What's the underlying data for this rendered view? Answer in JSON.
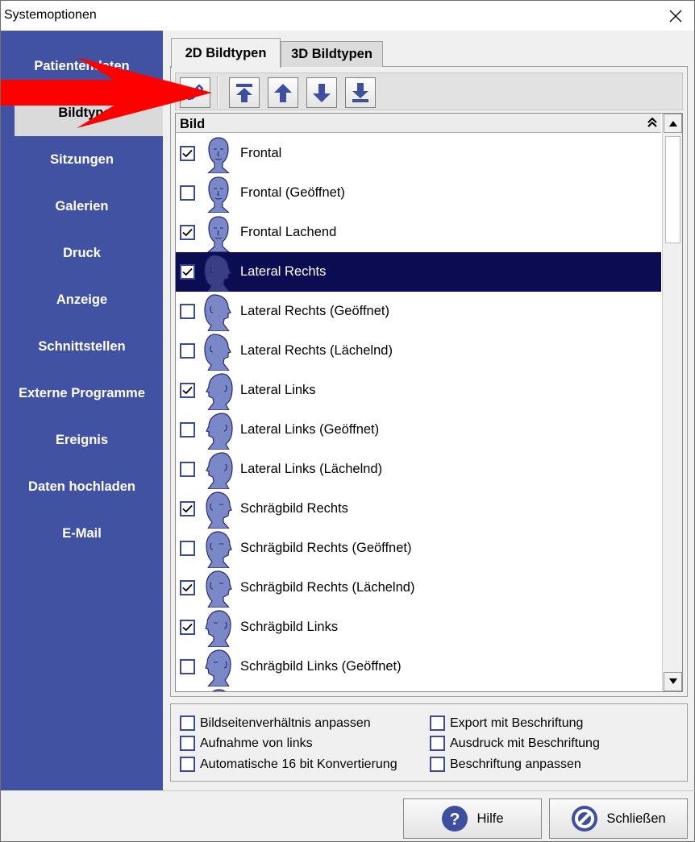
{
  "window": {
    "title": "Systemoptionen"
  },
  "sidebar": {
    "items": [
      {
        "label": "Patientendaten"
      },
      {
        "label": "Bildtypen",
        "active": true
      },
      {
        "label": "Sitzungen"
      },
      {
        "label": "Galerien"
      },
      {
        "label": "Druck"
      },
      {
        "label": "Anzeige"
      },
      {
        "label": "Schnittstellen"
      },
      {
        "label": "Externe Programme"
      },
      {
        "label": "Ereignis"
      },
      {
        "label": "Daten hochladen"
      },
      {
        "label": "E-Mail"
      }
    ]
  },
  "tabs": [
    {
      "label": "2D Bildtypen",
      "active": true
    },
    {
      "label": "3D Bildtypen",
      "active": false
    }
  ],
  "toolbar": {
    "icons": [
      "edit-icon",
      "move-to-top-icon",
      "move-up-icon",
      "move-down-icon",
      "move-to-bottom-icon"
    ]
  },
  "list": {
    "header": "Bild",
    "rows": [
      {
        "label": "Frontal",
        "checked": true,
        "view": "front"
      },
      {
        "label": "Frontal (Geöffnet)",
        "checked": false,
        "view": "front"
      },
      {
        "label": "Frontal Lachend",
        "checked": true,
        "view": "front"
      },
      {
        "label": "Lateral Rechts",
        "checked": true,
        "view": "right",
        "selected": true
      },
      {
        "label": "Lateral Rechts (Geöffnet)",
        "checked": false,
        "view": "right"
      },
      {
        "label": "Lateral Rechts (Lächelnd)",
        "checked": false,
        "view": "right"
      },
      {
        "label": "Lateral Links",
        "checked": true,
        "view": "left"
      },
      {
        "label": "Lateral Links (Geöffnet)",
        "checked": false,
        "view": "left"
      },
      {
        "label": "Lateral Links (Lächelnd)",
        "checked": false,
        "view": "left"
      },
      {
        "label": "Schrägbild Rechts",
        "checked": true,
        "view": "oblique-right"
      },
      {
        "label": "Schrägbild Rechts (Geöffnet)",
        "checked": false,
        "view": "oblique-right"
      },
      {
        "label": "Schrägbild Rechts (Lächelnd)",
        "checked": true,
        "view": "oblique-right"
      },
      {
        "label": "Schrägbild Links",
        "checked": true,
        "view": "oblique-left"
      },
      {
        "label": "Schrägbild Links (Geöffnet)",
        "checked": false,
        "view": "oblique-left"
      },
      {
        "label": "",
        "checked": false,
        "view": "oblique-left"
      }
    ]
  },
  "options": {
    "left": [
      {
        "label": "Bildseitenverhältnis anpassen",
        "checked": false
      },
      {
        "label": "Aufnahme von links",
        "checked": false
      },
      {
        "label": "Automatische 16 bit Konvertierung",
        "checked": false
      }
    ],
    "right": [
      {
        "label": "Export mit Beschriftung",
        "checked": false
      },
      {
        "label": "Ausdruck mit Beschriftung",
        "checked": false
      },
      {
        "label": "Beschriftung anpassen",
        "checked": false
      }
    ]
  },
  "buttons": {
    "help": "Hilfe",
    "close": "Schließen"
  },
  "colors": {
    "sidebar": "#4252a3",
    "selection": "#0c0c52",
    "icon_blue": "#3f4f9f",
    "annotation_arrow": "#ff0000"
  }
}
